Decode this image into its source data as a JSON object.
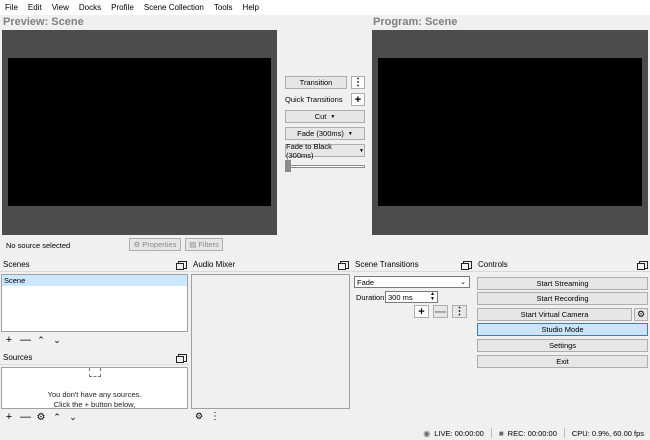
{
  "menu": [
    "File",
    "Edit",
    "View",
    "Docks",
    "Profile",
    "Scene Collection",
    "Tools",
    "Help"
  ],
  "preview": {
    "title": "Preview: Scene"
  },
  "program": {
    "title": "Program: Scene"
  },
  "transition_panel": {
    "transition_button": "Transition",
    "quick_transitions_label": "Quick Transitions",
    "cut": "Cut",
    "fade": "Fade (300ms)",
    "fade_to_black": "Fade to Black (300ms)",
    "tbar_value": 0
  },
  "source_bar": {
    "no_source": "No source selected",
    "properties": "Properties",
    "filters": "Filters"
  },
  "scenes": {
    "title": "Scenes",
    "items": [
      "Scene"
    ]
  },
  "sources": {
    "title": "Sources",
    "empty_line1": "You don't have any sources.",
    "empty_line2": "Click the + button below,"
  },
  "audio_mixer": {
    "title": "Audio Mixer"
  },
  "scene_transitions": {
    "title": "Scene Transitions",
    "selected": "Fade",
    "duration_label": "Duration",
    "duration_value": "300 ms"
  },
  "controls": {
    "title": "Controls",
    "start_streaming": "Start Streaming",
    "start_recording": "Start Recording",
    "start_virtual_camera": "Start Virtual Camera",
    "studio_mode": "Studio Mode",
    "settings": "Settings",
    "exit": "Exit"
  },
  "status": {
    "live": "LIVE: 00:00:00",
    "rec": "REC: 00:00:00",
    "cpu": "CPU: 0.9%, 60.00 fps"
  },
  "colors": {
    "accent": "#cce4f7",
    "accent_border": "#3c7fb1",
    "preview_frame": "#4c4c4c"
  }
}
